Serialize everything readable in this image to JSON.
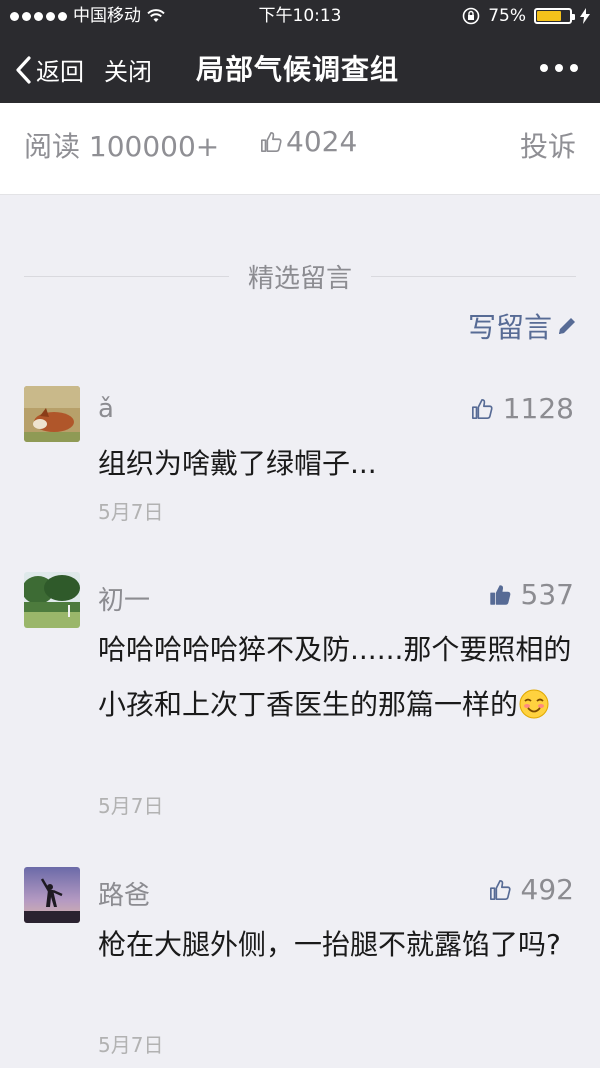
{
  "status_bar": {
    "carrier": "中国移动",
    "time": "下午10:13",
    "battery": "75%",
    "battery_level": 0.75
  },
  "nav": {
    "back_label": "返回",
    "close_label": "关闭",
    "title": "局部气候调查组"
  },
  "stats": {
    "reads": "阅读 100000+",
    "likes": "4024",
    "report": "投诉"
  },
  "section": {
    "title": "精选留言",
    "write_label": "写留言"
  },
  "comments": [
    {
      "name": "ǎ",
      "likes": "1128",
      "text": "组织为啥戴了绿帽子...",
      "date": "5月7日",
      "liked": false
    },
    {
      "name": "初一",
      "likes": "537",
      "text": "哈哈哈哈哈猝不及防......那个要照相的小孩和上次丁香医生的那篇一样的",
      "date": "5月7日",
      "liked": true,
      "emoji": "smiling-face-icon"
    },
    {
      "name": "路爸",
      "likes": "492",
      "text": "枪在大腿外侧，一抬腿不就露馅了吗?",
      "date": "5月7日",
      "liked": false
    }
  ]
}
